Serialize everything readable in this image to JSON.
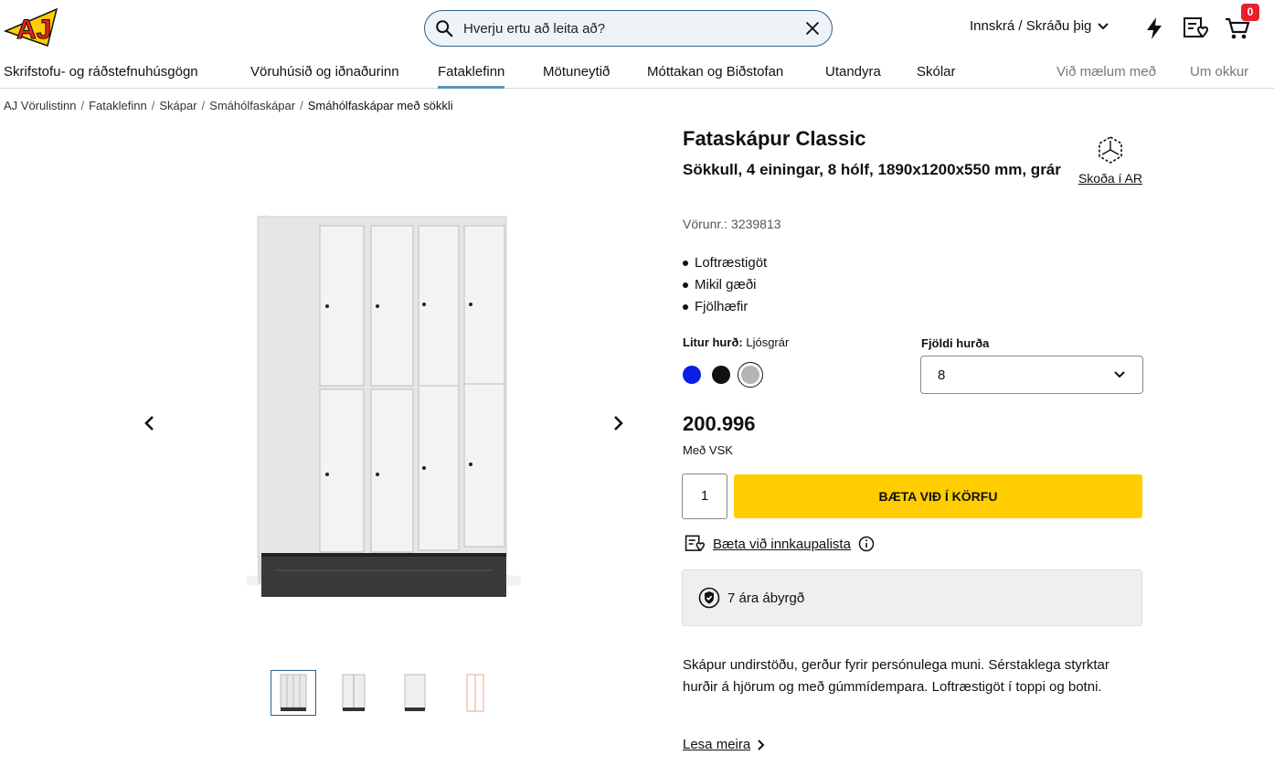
{
  "header": {
    "logo_text": "AJ",
    "search_placeholder": "Hverju ertu að leita að?",
    "login_label": "Innskrá / Skráðu þig",
    "cart_count": "0"
  },
  "nav": {
    "items": [
      "Skrifstofu- og ráðstefnuhúsgögn",
      "Vöruhúsið og iðnaðurinn",
      "Fataklefinn",
      "Mötuneytið",
      "Móttakan og Biðstofan",
      "Utandyra",
      "Skólar",
      "Við mælum með",
      "Um okkur"
    ],
    "active": "Fataklefinn"
  },
  "breadcrumb": [
    "AJ Vörulistinn",
    "Fataklefinn",
    "Skápar",
    "Smáhólfaskápar",
    "Smáhólfaskápar með sökkli"
  ],
  "product": {
    "title": "Fataskápur Classic",
    "subtitle": "Sökkull, 4 einingar, 8 hólf, 1890x1200x550 mm, grár",
    "ar_label": "Skoða í AR",
    "sku_label": "Vörunr.:",
    "sku": "3239813",
    "features": [
      "Loftræstigöt",
      "Mikil gæði",
      "Fjölhæfir"
    ],
    "color_label": "Litur hurð:",
    "color_value": "Ljósgrár",
    "swatches": [
      "#0a1fe6",
      "#111111",
      "#b5b5b5"
    ],
    "doors_label": "Fjöldi hurða",
    "doors_value": "8",
    "price": "200.996",
    "vat_label": "Með VSK",
    "quantity": "1",
    "add_to_cart": "BÆTA VIÐ Í KÖRFU",
    "shopping_list": "Bæta við innkaupalista",
    "warranty": "7 ára ábyrgð",
    "description": "Skápur undirstöðu, gerður fyrir persónulega muni. Sérstaklega styrktar hurðir á hjörum og með gúmmídempara. Loftræstigöt í toppi og botni.",
    "read_more": "Lesa meira"
  },
  "colors": {
    "accent_yellow": "#ffcd00",
    "badge_red": "#e8202a",
    "nav_underline": "#5b93b8"
  }
}
